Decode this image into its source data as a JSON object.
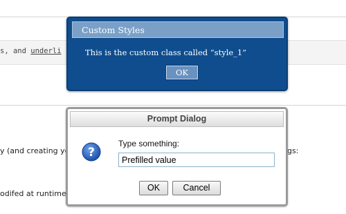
{
  "background_page": {
    "code_line_prefix": "s, and ",
    "code_line_underlined": "underli",
    "text_line_1": "y (and creating yo",
    "text_line_1_right": "ngs:",
    "text_line_2": "odifed at runtime."
  },
  "custom_styles_dialog": {
    "title": "Custom Styles",
    "message": "This is the custom class called “style_1”",
    "ok_label": "OK"
  },
  "prompt_dialog": {
    "title": "Prompt Dialog",
    "icon": "question-icon",
    "label": "Type something:",
    "input_value": "Prefilled value",
    "ok_label": "OK",
    "cancel_label": "Cancel"
  },
  "colors": {
    "custom_dialog_bg": "#0f4d8e",
    "custom_titlebar": "#7aa0c8",
    "prompt_border": "#9a9a9a",
    "question_icon": "#1f5fbf"
  }
}
